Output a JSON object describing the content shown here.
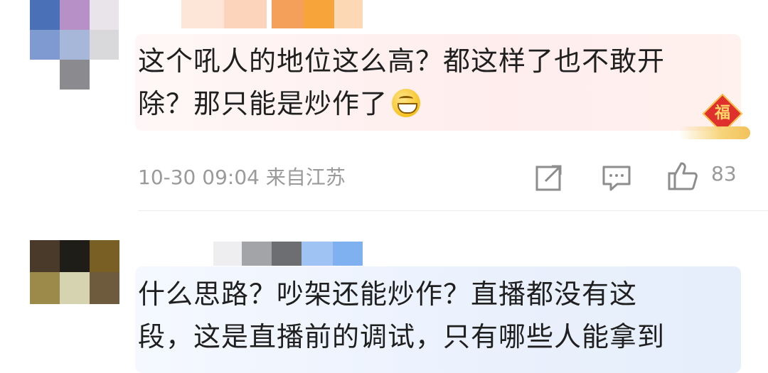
{
  "comments": [
    {
      "text_lines": [
        "这个吼人的地位这么高？都这样了也不敢开",
        "除？那只能是炒作了"
      ],
      "emoji": "grin-emoji",
      "badge": "福",
      "meta": "10-30 09:04 来自江苏",
      "likes": "83",
      "bubble_color": "#ffeded"
    },
    {
      "text_lines": [
        "什么思路？吵架还能炒作？直播都没有这",
        "段，这是直播前的调试，只有哪些人能拿到"
      ],
      "bubble_color": "#eaf1fd"
    }
  ],
  "icons": [
    "share-icon",
    "comment-icon",
    "like-icon"
  ],
  "colors": {
    "text": "#1f1f1f",
    "meta": "#9a9a9a",
    "badge_red": "#e0302d"
  }
}
